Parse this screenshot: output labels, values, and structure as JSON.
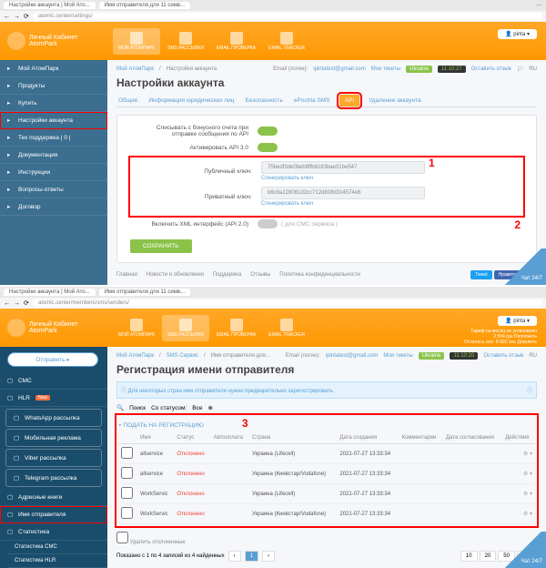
{
  "browser": {
    "tab1": "Настройки аккаунта | Мой Ато...",
    "tab2": "Имя отправителя для 11 симв...",
    "url1": "atomic.center/settings/",
    "url2": "atomic.center/members/sms/senders/"
  },
  "app": {
    "brand_line1": "Личный Кабинет",
    "brand_line2": "AtomPark",
    "user": "pinta",
    "user_sub1": "Тариф на месяц  не установлен",
    "user_sub2": "2 594 грн  Пополнить",
    "user_sub3": "Осталось смс: 8 892 смс  Докупить",
    "topnav1": [
      {
        "label": "МОЙ АТОМПАРК",
        "active": true
      },
      {
        "label": "SMS РАССЫЛКИ"
      },
      {
        "label": "EMAIL ПРОВЕРКА"
      },
      {
        "label": "EMAIL TRACKER"
      }
    ],
    "topnav2": [
      {
        "label": "МОЙ АТОМПАРК"
      },
      {
        "label": "SMS РАССЫЛКИ",
        "active": true
      },
      {
        "label": "EMAIL ПРОВЕРКА"
      },
      {
        "label": "EMAIL TRACKER"
      }
    ]
  },
  "crumbs": {
    "root": "Мой АтомПарк",
    "page1": "Настройки аккаунта",
    "sms": "SMS Сервис",
    "page2": "Имя отправителя для...",
    "email_lbl": "Email (логин):",
    "email": "ipintatest@gmail.com",
    "tickets": "Мои тикеты",
    "country": "Ukraine",
    "time": "11:10:27",
    "time2": "11:10:20",
    "review": "Оставить отзыв",
    "lang": "RU"
  },
  "page1": {
    "title": "Настройки аккаунта",
    "tabs": [
      "Общие",
      "Информация юридических лиц",
      "Безопасность",
      "ePochta SMS",
      "API",
      "Удаление аккаунта"
    ],
    "active_tab": 4,
    "row1_lbl": "Списывать с бонусного счета при отправке сообщения по API",
    "row2_lbl": "Активировать API 3.0",
    "pub_lbl": "Публичный ключ:",
    "pub_val": "75bedf3de0beb8ffb6183bae01be547",
    "gen": "Сгенерировать ключ",
    "priv_lbl": "Приватный ключ:",
    "priv_val": "b6c8a128081d2cc712d808d314574e6",
    "row3_lbl": "Включить XML интерфейс (API 2.0)",
    "row3_note": "( для СМС сервиса )",
    "save": "СОХРАНИТЬ",
    "step1": "1",
    "step2": "2"
  },
  "footer": {
    "links": [
      "Главная",
      "Новости и обновления",
      "Поддержка",
      "Отзывы",
      "Политика конфиденциальности"
    ],
    "tweet": "Tweet",
    "like": "Нравится 1 тыс.",
    "chat": "Чат 24/7"
  },
  "sidebar1": [
    {
      "label": "Мой АтомПарк"
    },
    {
      "label": "Продукты"
    },
    {
      "label": "Купить"
    },
    {
      "label": "Настройки аккаунта",
      "hl": true
    },
    {
      "label": "Тех поддержка  | 0 |"
    },
    {
      "label": "Документация"
    },
    {
      "label": "Инструкции"
    },
    {
      "label": "Вопросы-ответы"
    },
    {
      "label": "Договор"
    }
  ],
  "sidebar2": {
    "send": "Отправить",
    "items": [
      {
        "label": "СМС"
      },
      {
        "label": "HLR",
        "chip": "New"
      },
      {
        "label": "WhatsApp рассылка",
        "boxed": true
      },
      {
        "label": "Мобильная реклама",
        "boxed": true
      },
      {
        "label": "Viber рассылка",
        "boxed": true
      },
      {
        "label": "Telegram рассылка",
        "boxed": true
      },
      {
        "label": "Адресные книги"
      },
      {
        "label": "Имя отправителя",
        "hl": true
      },
      {
        "label": "Статистика"
      }
    ],
    "sub": [
      "Статистика СМС",
      "Статистика HLR"
    ]
  },
  "page2": {
    "title": "Регистрация имени отправителя",
    "info": "Для некоторых стран имя отправителя нужно предварительно зарегистрировать",
    "search": "Поиск",
    "status_lbl": "Со статусом:",
    "status_val": "Все",
    "reg_link": "+   ПОДАТЬ НА РЕГИСТРАЦИЮ",
    "step3": "3",
    "cols": [
      "",
      "Имя",
      "Статус",
      "Автооплата",
      "Страна",
      "Дата создания",
      "Комментарии",
      "Дата согласования",
      "Действия"
    ],
    "rows": [
      {
        "name": "allservice",
        "status": "Отклонено",
        "country": "Украина (Lifecell)",
        "date": "2021-07-27 13:33:34"
      },
      {
        "name": "allservice",
        "status": "Отклонено",
        "country": "Украина (Киевстар/Vodafone)",
        "date": "2021-07-27 13:33:34"
      },
      {
        "name": "WorkServic",
        "status": "Отклонено",
        "country": "Украина (Lifecell)",
        "date": "2021-07-27 13:33:34"
      },
      {
        "name": "WorkServic",
        "status": "Отклонено",
        "country": "Украина (Киевстар/Vodafone)",
        "date": "2021-07-27 13:33:34"
      }
    ],
    "summary": "Показано с 1 по 4 записей из 4 найденных",
    "pages": [
      "10",
      "20",
      "50",
      "100"
    ]
  }
}
